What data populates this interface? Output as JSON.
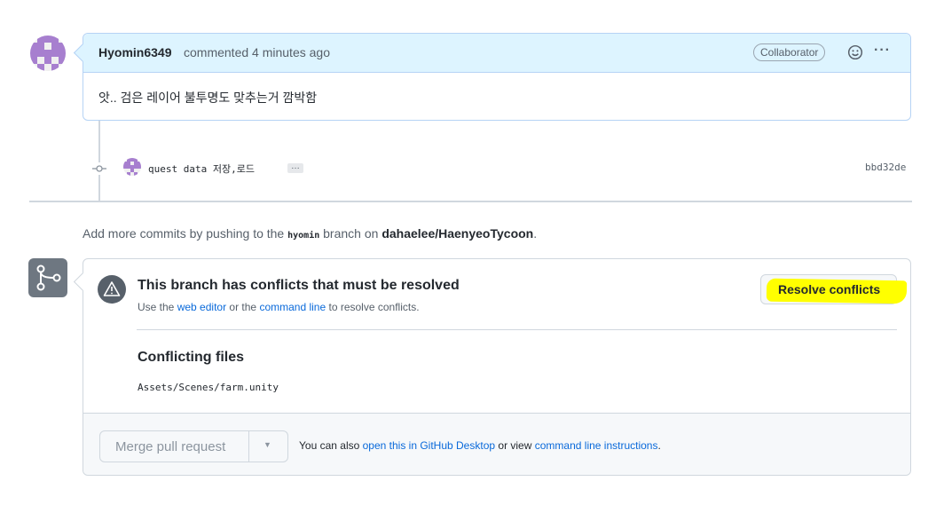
{
  "comment": {
    "author": "Hyomin6349",
    "meta": "commented 4 minutes ago",
    "badge": "Collaborator",
    "body": "앗.. 검은 레이어 불투명도 맞추는거 깜박함"
  },
  "commit": {
    "message": "quest data 저장,로드",
    "more": "…",
    "sha": "bbd32de"
  },
  "add_more": {
    "prefix": "Add more commits by pushing to the",
    "branch": "hyomin",
    "middle": "branch on",
    "repo": "dahaelee/HaenyeoTycoon",
    "suffix": "."
  },
  "conflict": {
    "title": "This branch has conflicts that must be resolved",
    "sub_prefix": "Use the",
    "web_editor": "web editor",
    "sub_or": "or the",
    "command_line": "command line",
    "sub_suffix": "to resolve conflicts.",
    "resolve_label": "Resolve conflicts",
    "files_title": "Conflicting files",
    "files": [
      "Assets/Scenes/farm.unity"
    ]
  },
  "merge": {
    "button_label": "Merge pull request",
    "also_prefix": "You can also",
    "desktop_link": "open this in GitHub Desktop",
    "or_view": "or view",
    "cli_link": "command line instructions",
    "suffix": "."
  },
  "colors": {
    "accent": "#0969da",
    "highlight": "#ffff00",
    "identicon": "#a77fcf"
  }
}
